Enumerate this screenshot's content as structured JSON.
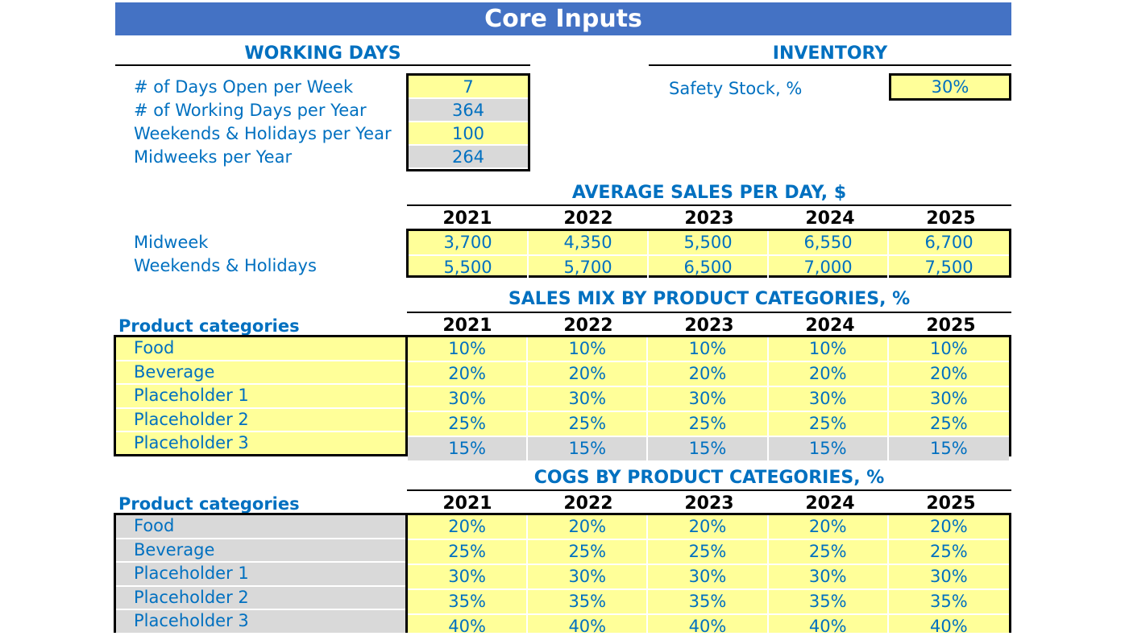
{
  "title": "Core Inputs",
  "working_days": {
    "heading": "WORKING DAYS",
    "rows": [
      {
        "label": "# of Days Open per Week",
        "value": "7",
        "style": "input"
      },
      {
        "label": "# of Working Days per Year",
        "value": "364",
        "style": "calc"
      },
      {
        "label": "Weekends & Holidays per Year",
        "value": "100",
        "style": "input"
      },
      {
        "label": "Midweeks per Year",
        "value": "264",
        "style": "calc"
      }
    ]
  },
  "inventory": {
    "heading": "INVENTORY",
    "safety_stock_label": "Safety Stock, %",
    "safety_stock_value": "30%"
  },
  "years": [
    "2021",
    "2022",
    "2023",
    "2024",
    "2025"
  ],
  "avg_sales": {
    "heading": "AVERAGE SALES PER DAY, $",
    "rows": [
      {
        "label": "Midweek",
        "values": [
          "3,700",
          "4,350",
          "5,500",
          "6,550",
          "6,700"
        ]
      },
      {
        "label": "Weekends & Holidays",
        "values": [
          "5,500",
          "5,700",
          "6,500",
          "7,000",
          "7,500"
        ]
      }
    ]
  },
  "sales_mix": {
    "heading": "SALES MIX BY PRODUCT CATEGORIES, %",
    "column_label": "Product categories",
    "rows": [
      {
        "label": "Food",
        "values": [
          "10%",
          "10%",
          "10%",
          "10%",
          "10%"
        ]
      },
      {
        "label": "Beverage",
        "values": [
          "20%",
          "20%",
          "20%",
          "20%",
          "20%"
        ]
      },
      {
        "label": "Placeholder 1",
        "values": [
          "30%",
          "30%",
          "30%",
          "30%",
          "30%"
        ]
      },
      {
        "label": "Placeholder 2",
        "values": [
          "25%",
          "25%",
          "25%",
          "25%",
          "25%"
        ]
      },
      {
        "label": "Placeholder 3",
        "values": [
          "15%",
          "15%",
          "15%",
          "15%",
          "15%"
        ]
      }
    ]
  },
  "cogs": {
    "heading": "COGS BY PRODUCT CATEGORIES, %",
    "column_label": "Product categories",
    "rows": [
      {
        "label": "Food",
        "values": [
          "20%",
          "20%",
          "20%",
          "20%",
          "20%"
        ]
      },
      {
        "label": "Beverage",
        "values": [
          "25%",
          "25%",
          "25%",
          "25%",
          "25%"
        ]
      },
      {
        "label": "Placeholder 1",
        "values": [
          "30%",
          "30%",
          "30%",
          "30%",
          "30%"
        ]
      },
      {
        "label": "Placeholder 2",
        "values": [
          "35%",
          "35%",
          "35%",
          "35%",
          "35%"
        ]
      },
      {
        "label": "Placeholder 3",
        "values": [
          "40%",
          "40%",
          "40%",
          "40%",
          "40%"
        ]
      }
    ]
  },
  "colors": {
    "title_bar": "#4472C4",
    "text_blue": "#0070C0",
    "input_fill": "#FFFF99",
    "calc_fill": "#D9D9D9"
  }
}
